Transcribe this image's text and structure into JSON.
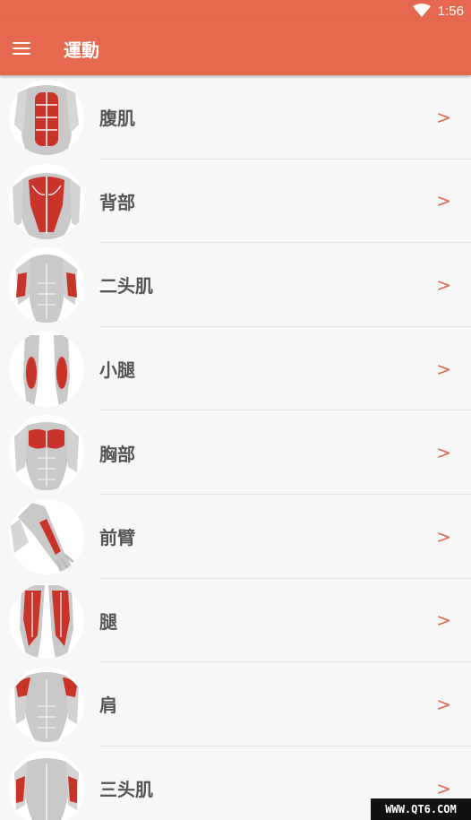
{
  "status_bar": {
    "time": "1:56",
    "wifi_icon": "wifi-icon"
  },
  "app_bar": {
    "title": "運動",
    "menu_icon": "hamburger-menu-icon"
  },
  "colors": {
    "accent": "#e5684f",
    "muscle": "#c8332a",
    "body": "#c9c9c9",
    "label": "#555555"
  },
  "exercises": [
    {
      "label": "腹肌",
      "icon": "abs-muscle-icon"
    },
    {
      "label": "背部",
      "icon": "back-muscle-icon"
    },
    {
      "label": "二头肌",
      "icon": "biceps-muscle-icon"
    },
    {
      "label": "小腿",
      "icon": "calves-muscle-icon"
    },
    {
      "label": "胸部",
      "icon": "chest-muscle-icon"
    },
    {
      "label": "前臂",
      "icon": "forearm-muscle-icon"
    },
    {
      "label": "腿",
      "icon": "legs-muscle-icon"
    },
    {
      "label": "肩",
      "icon": "shoulders-muscle-icon"
    },
    {
      "label": "三头肌",
      "icon": "triceps-muscle-icon"
    }
  ],
  "chevron": ">",
  "watermark": "WWW.QT6.COM"
}
